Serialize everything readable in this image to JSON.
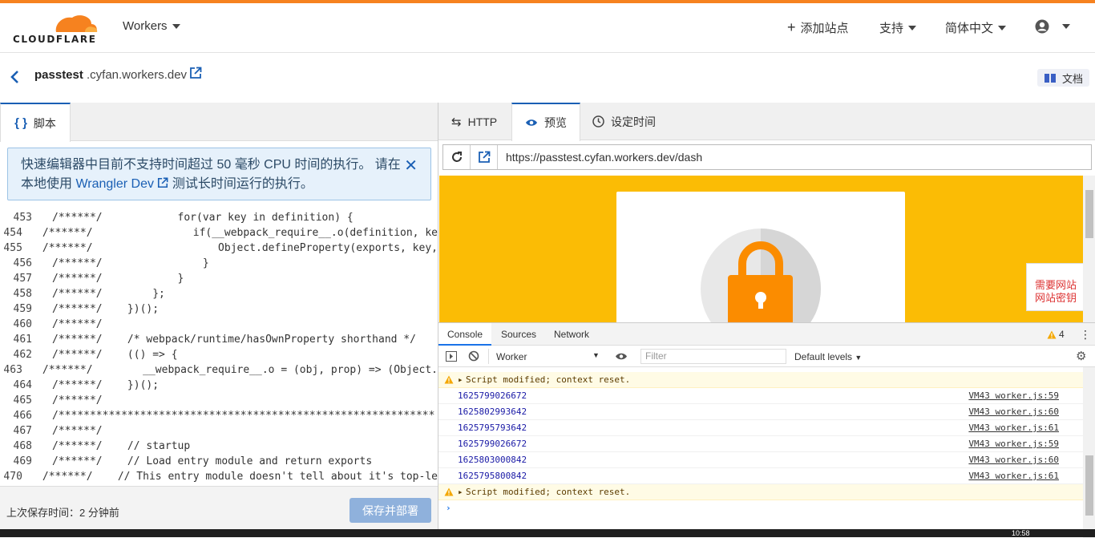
{
  "colors": {
    "accent": "#f6821f",
    "link": "#1a5fb4",
    "preview_bg": "#fbbc05",
    "lock": "#fb8c00"
  },
  "topnav": {
    "logo_text": "CLOUDFLARE",
    "product": "Workers",
    "add_site": "添加站点",
    "support": "支持",
    "language": "简体中文"
  },
  "subheader": {
    "worker_name": "passtest",
    "worker_domain": ".cyfan.workers.dev",
    "docs": "文档"
  },
  "left": {
    "tab_label": "脚本",
    "notice_line1": "快速编辑器中目前不支持时间超过 50 毫秒 CPU 时间的执行。 请在",
    "notice_pre": "本地使用 ",
    "notice_link": "Wrangler Dev",
    "notice_post": " 测试长时间运行的执行。",
    "saved_time": "上次保存时间：2 分钟前",
    "deploy_button": "保存并部署",
    "code_lines": [
      {
        "n": "453",
        "t": "/******/            for(var key in definition) {"
      },
      {
        "n": "454",
        "t": "/******/                if(__webpack_require__.o(definition, ke"
      },
      {
        "n": "455",
        "t": "/******/                    Object.defineProperty(exports, key,"
      },
      {
        "n": "456",
        "t": "/******/                }"
      },
      {
        "n": "457",
        "t": "/******/            }"
      },
      {
        "n": "458",
        "t": "/******/        };"
      },
      {
        "n": "459",
        "t": "/******/    })();"
      },
      {
        "n": "460",
        "t": "/******/"
      },
      {
        "n": "461",
        "t": "/******/    /* webpack/runtime/hasOwnProperty shorthand */"
      },
      {
        "n": "462",
        "t": "/******/    (() => {"
      },
      {
        "n": "463",
        "t": "/******/        __webpack_require__.o = (obj, prop) => (Object."
      },
      {
        "n": "464",
        "t": "/******/    })();"
      },
      {
        "n": "465",
        "t": "/******/"
      },
      {
        "n": "466",
        "t": "/************************************************************"
      },
      {
        "n": "467",
        "t": "/******/"
      },
      {
        "n": "468",
        "t": "/******/    // startup"
      },
      {
        "n": "469",
        "t": "/******/    // Load entry module and return exports"
      },
      {
        "n": "470",
        "t": "/******/    // This entry module doesn't tell about it's top-le"
      }
    ]
  },
  "right": {
    "tab_http": "HTTP",
    "tab_preview": "预览",
    "tab_schedule": "设定时间",
    "url": "https://passtest.cyfan.workers.dev/dash",
    "side_card_line1": "需要网站",
    "side_card_line2": "网站密钥"
  },
  "devtools": {
    "tab_console": "Console",
    "tab_sources": "Sources",
    "tab_network": "Network",
    "warn_count": "4",
    "context": "Worker",
    "filter_placeholder": "Filter",
    "levels": "Default levels",
    "rows": [
      {
        "type": "warn",
        "msg": "Script modified; context reset.",
        "src": ""
      },
      {
        "type": "log",
        "msg": "1625799026672",
        "src": "VM43 worker.js:59"
      },
      {
        "type": "log",
        "msg": "1625802993642",
        "src": "VM43 worker.js:60"
      },
      {
        "type": "log",
        "msg": "1625795793642",
        "src": "VM43 worker.js:61"
      },
      {
        "type": "log",
        "msg": "1625799026672",
        "src": "VM43 worker.js:59"
      },
      {
        "type": "log",
        "msg": "1625803000842",
        "src": "VM43 worker.js:60"
      },
      {
        "type": "log",
        "msg": "1625795800842",
        "src": "VM43 worker.js:61"
      },
      {
        "type": "warn",
        "msg": "Script modified; context reset.",
        "src": ""
      }
    ]
  },
  "taskbar": {
    "clock": "10:58"
  }
}
